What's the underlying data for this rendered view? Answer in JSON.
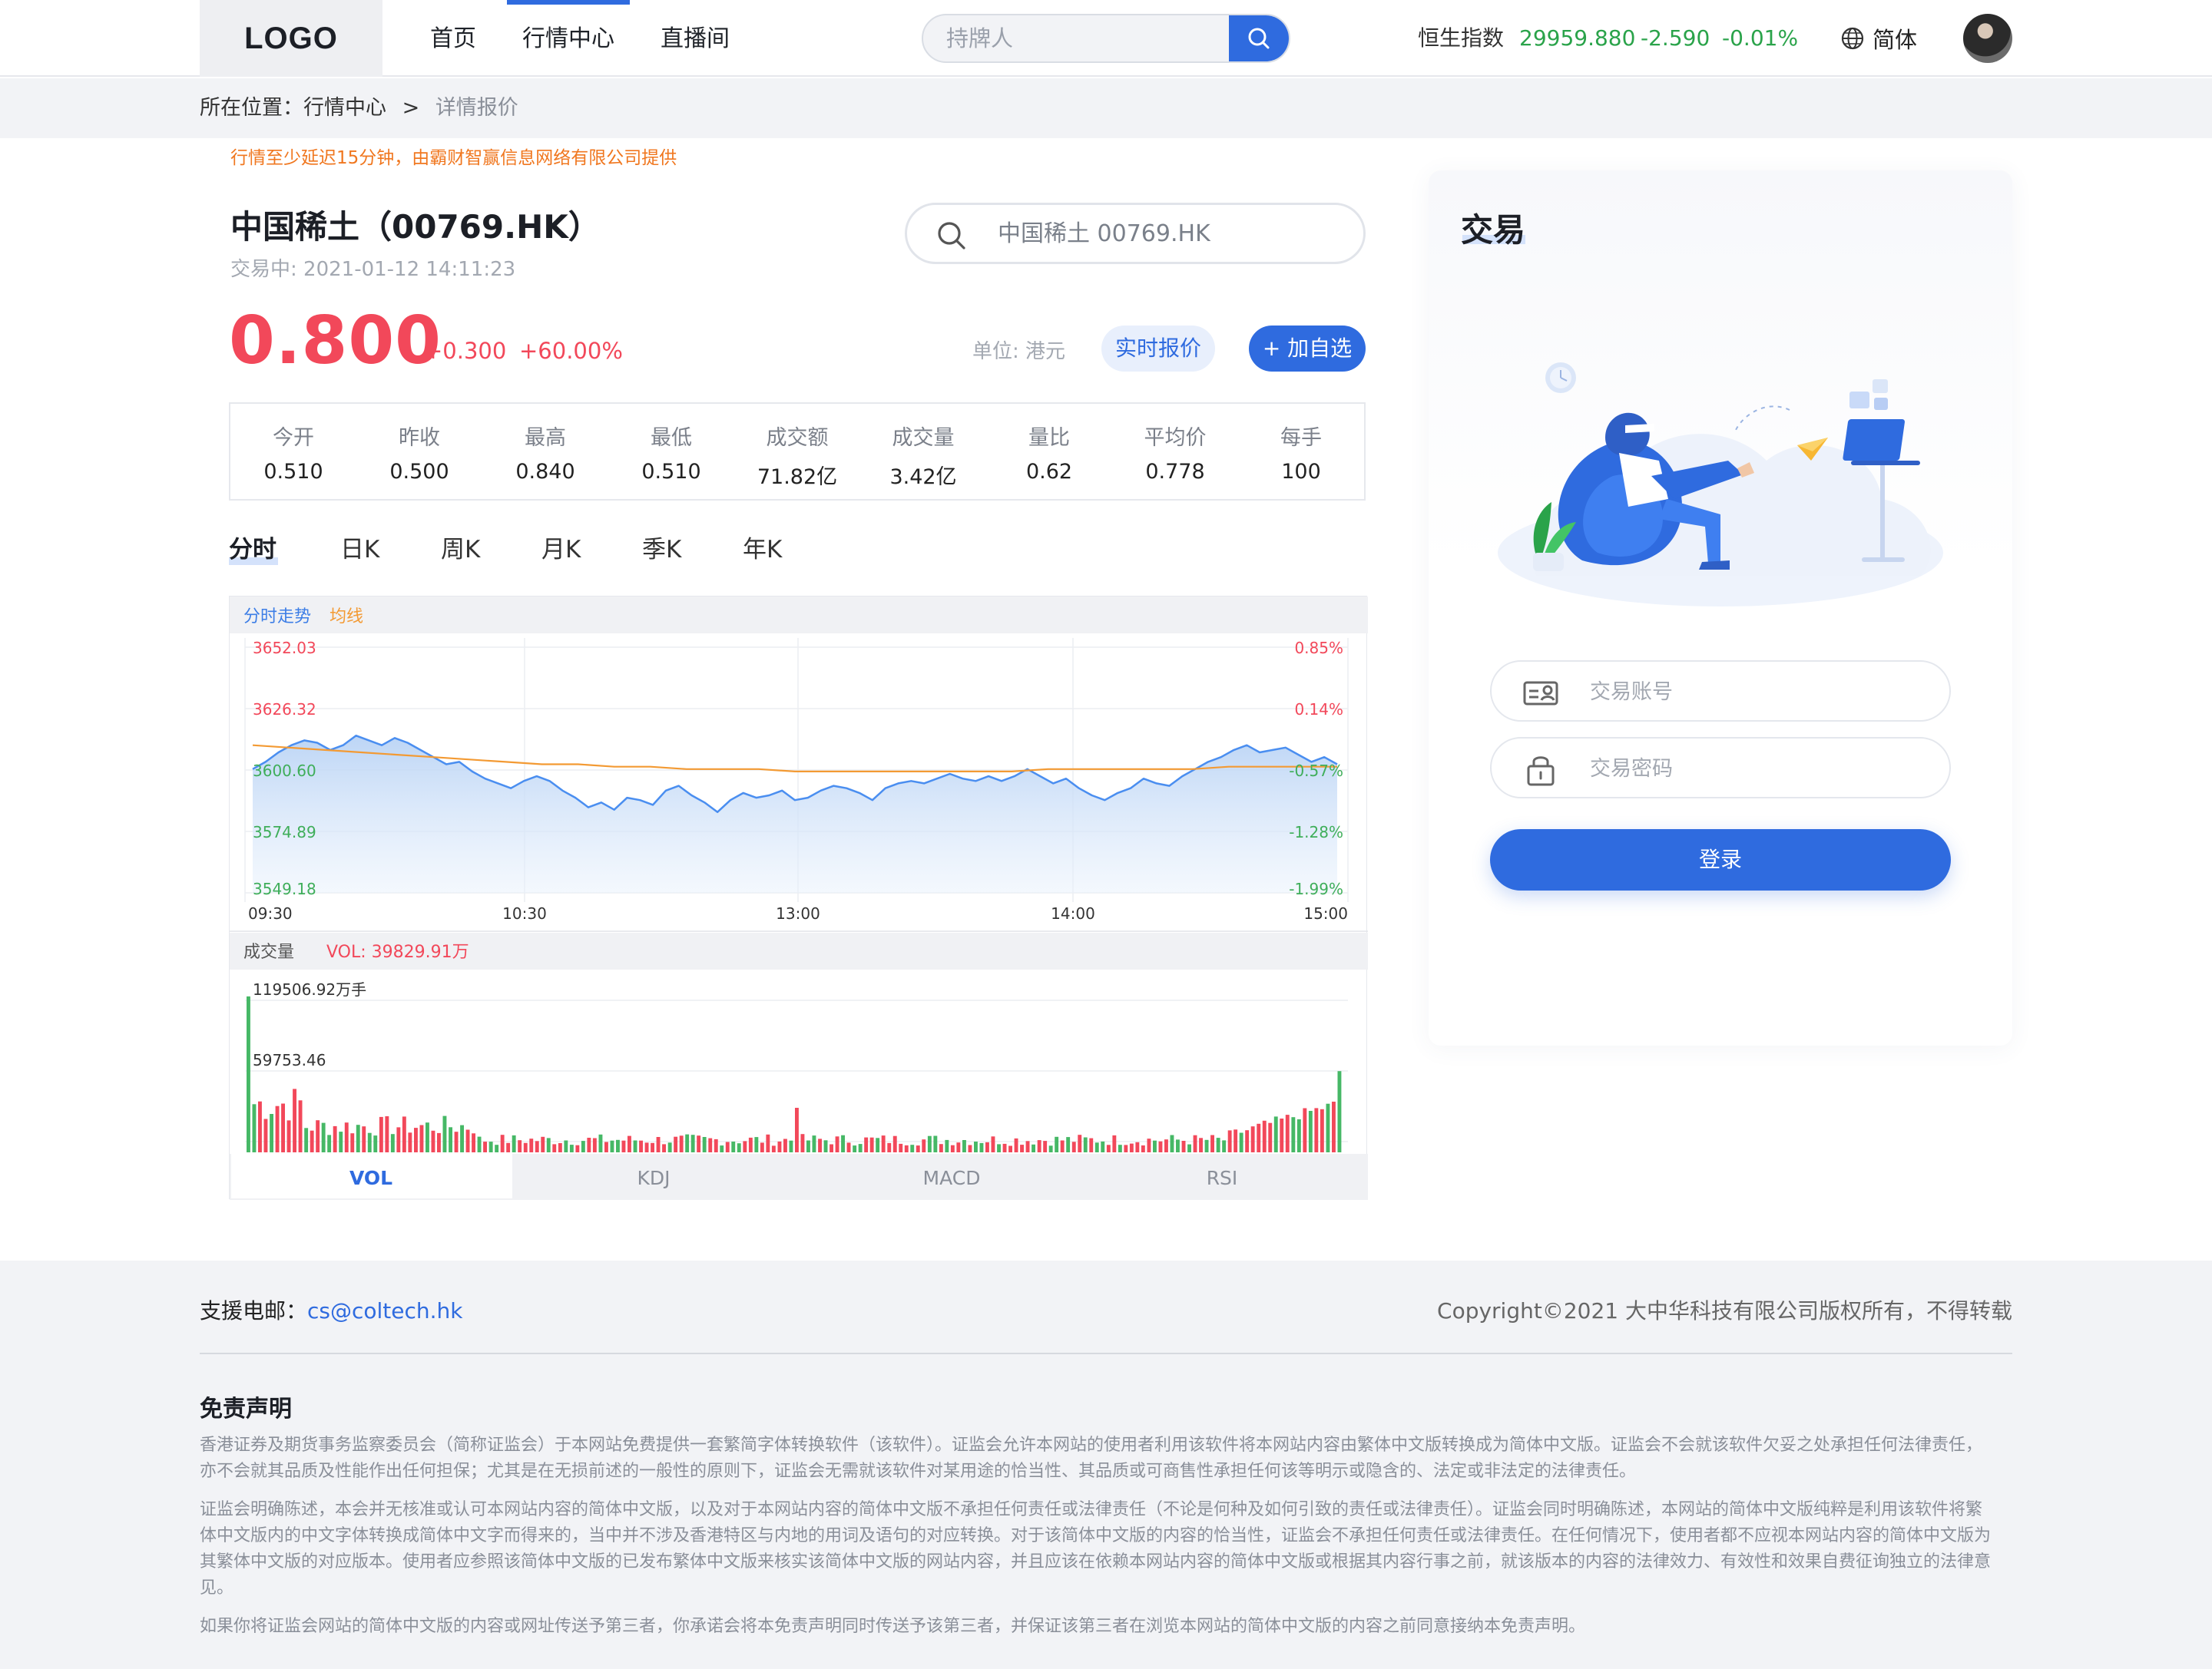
{
  "header": {
    "logo": "LOGO",
    "nav": [
      "首页",
      "行情中心",
      "直播间"
    ],
    "search_placeholder": "持牌人",
    "index_name": "恒生指数",
    "index_value": "29959.880",
    "index_change": "-2.590",
    "index_pct": "-0.01%",
    "language": "简体"
  },
  "breadcrumb": {
    "prefix": "所在位置：",
    "section": "行情中心",
    "separator": ">",
    "current": "详情报价"
  },
  "notice": "行情至少延迟15分钟，由霸财智赢信息网络有限公司提供",
  "stock": {
    "name": "中国稀土（00769.HK）",
    "status_time": "交易中: 2021-01-12 14:11:23",
    "price": "0.800",
    "change": "+0.300",
    "change_pct": "+60.00%",
    "search_placeholder": "中国稀土 00769.HK",
    "unit": "单位: 港元",
    "realtime_label": "实时报价",
    "watch_label": "+ 加自选"
  },
  "stats": [
    {
      "label": "今开",
      "value": "0.510"
    },
    {
      "label": "昨收",
      "value": "0.500"
    },
    {
      "label": "最高",
      "value": "0.840"
    },
    {
      "label": "最低",
      "value": "0.510"
    },
    {
      "label": "成交额",
      "value": "71.82亿"
    },
    {
      "label": "成交量",
      "value": "3.42亿"
    },
    {
      "label": "量比",
      "value": "0.62"
    },
    {
      "label": "平均价",
      "value": "0.778"
    },
    {
      "label": "每手",
      "value": "100"
    }
  ],
  "period_tabs": [
    "分时",
    "日K",
    "周K",
    "月K",
    "季K",
    "年K"
  ],
  "chart_data": [
    {
      "type": "line",
      "legend": [
        "分时走势",
        "均线"
      ],
      "y_left_ticks": [
        "3652.03",
        "3626.32",
        "3600.60",
        "3574.89",
        "3549.18"
      ],
      "y_right_ticks": [
        "0.85%",
        "0.14%",
        "-0.57%",
        "-1.28%",
        "-1.99%"
      ],
      "x_ticks": [
        "09:30",
        "10:30",
        "13:00",
        "14:00",
        "15:00"
      ],
      "ylim": [
        3549.18,
        3652.03
      ],
      "series": [
        {
          "name": "分时走势",
          "values": [
            3601,
            3604,
            3608,
            3611,
            3613,
            3612,
            3609,
            3611,
            3615,
            3613,
            3611,
            3614,
            3612,
            3609,
            3606,
            3603,
            3604,
            3600,
            3597,
            3595,
            3593,
            3596,
            3598,
            3596,
            3592,
            3589,
            3585,
            3587,
            3584,
            3589,
            3588,
            3586,
            3592,
            3594,
            3590,
            3587,
            3583,
            3588,
            3591,
            3589,
            3590,
            3592,
            3588,
            3589,
            3592,
            3594,
            3593,
            3591,
            3588,
            3593,
            3595,
            3596,
            3595,
            3597,
            3599,
            3597,
            3596,
            3598,
            3596,
            3598,
            3601,
            3598,
            3595,
            3597,
            3593,
            3590,
            3588,
            3591,
            3593,
            3597,
            3595,
            3594,
            3598,
            3601,
            3604,
            3606,
            3609,
            3611,
            3608,
            3609,
            3610,
            3607,
            3604,
            3606,
            3603
          ]
        },
        {
          "name": "均线",
          "values": [
            3611,
            3610,
            3609,
            3608,
            3607,
            3606,
            3605,
            3604,
            3603,
            3603,
            3602,
            3602,
            3601,
            3601,
            3601,
            3600,
            3600,
            3600,
            3600,
            3600,
            3600,
            3600,
            3601,
            3601,
            3601,
            3601,
            3601,
            3602,
            3602,
            3602,
            3602
          ]
        }
      ]
    },
    {
      "type": "bar",
      "title": "成交量",
      "vol_label": "VOL: 39829.91万",
      "y_ticks": [
        "119506.92万手",
        "59753.46"
      ],
      "ylim": [
        0,
        119506.92
      ]
    }
  ],
  "indicator_tabs": [
    "VOL",
    "KDJ",
    "MACD",
    "RSI"
  ],
  "trade": {
    "title": "交易",
    "account_placeholder": "交易账号",
    "password_placeholder": "交易密码",
    "login_label": "登录"
  },
  "footer": {
    "support_label": "支援电邮：",
    "support_email": "cs@coltech.hk",
    "copyright": "Copyright©2021 大中华科技有限公司版权所有，不得转载",
    "disclaimer_title": "免责声明",
    "disclaimer": [
      "香港证券及期货事务监察委员会（简称证监会）于本网站免费提供一套繁简字体转换软件（该软件）。证监会允许本网站的使用者利用该软件将本网站内容由繁体中文版转换成为简体中文版。证监会不会就该软件欠妥之处承担任何法律责任，亦不会就其品质及性能作出任何担保；尤其是在无损前述的一般性的原则下，证监会无需就该软件对某用途的恰当性、其品质或可商售性承担任何该等明示或隐含的、法定或非法定的法律责任。",
      "证监会明确陈述，本会并无核准或认可本网站内容的简体中文版，以及对于本网站内容的简体中文版不承担任何责任或法律责任（不论是何种及如何引致的责任或法律责任）。证监会同时明确陈述，本网站的简体中文版纯粹是利用该软件将繁体中文版内的中文字体转换成简体中文字而得来的，当中并不涉及香港特区与内地的用词及语句的对应转换。对于该简体中文版的内容的恰当性，证监会不承担任何责任或法律责任。在任何情况下，使用者都不应视本网站内容的简体中文版为其繁体中文版的对应版本。使用者应参照该简体中文版的已发布繁体中文版来核实该简体中文版的网站内容，并且应该在依赖本网站内容的简体中文版或根据其内容行事之前，就该版本的内容的法律效力、有效性和效果自费征询独立的法律意见。",
      "如果你将证监会网站的简体中文版的内容或网址传送予第三者，你承诺会将本免责声明同时传送予该第三者，并保证该第三者在浏览本网站的简体中文版的内容之前同意接纳本免责声明。"
    ]
  }
}
